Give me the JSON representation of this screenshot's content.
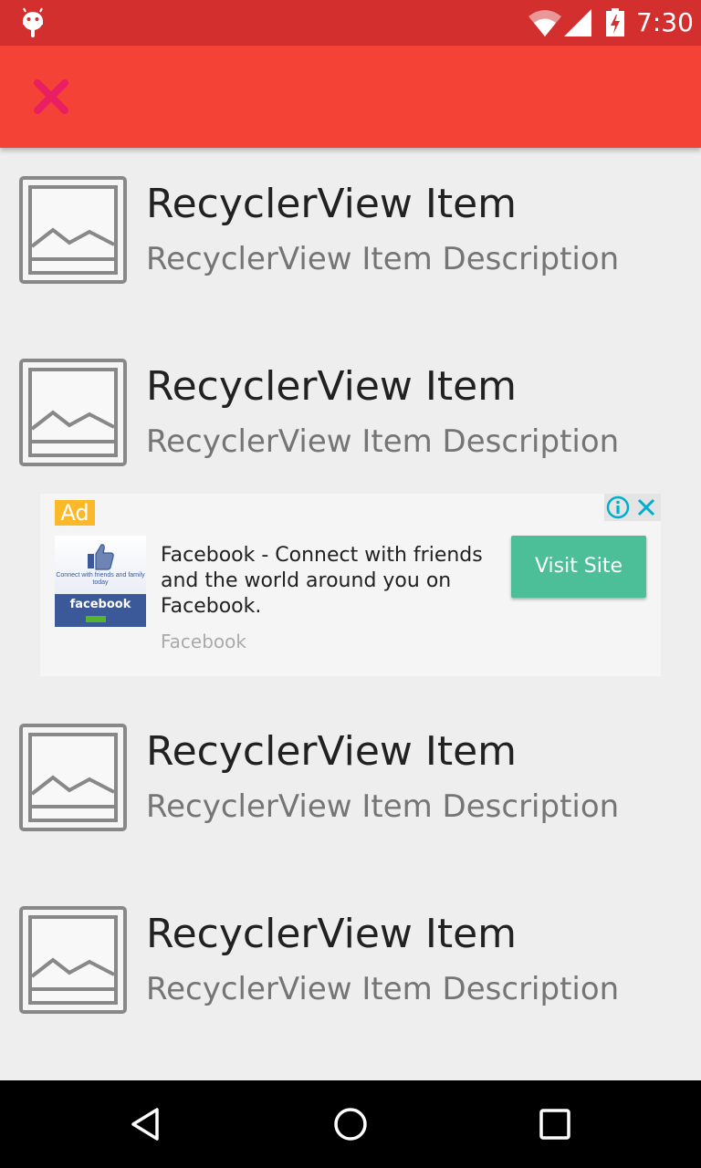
{
  "status_bar": {
    "time": "7:30",
    "background_color": "#d32f2f",
    "icons": [
      "android-icon",
      "wifi-icon",
      "signal-icon",
      "battery-charging-icon"
    ]
  },
  "app_bar": {
    "background_color": "#f44336",
    "close_icon_color": "#e91e63",
    "close_icon": "close-icon"
  },
  "list": {
    "items": [
      {
        "title": "RecyclerView Item",
        "description": "RecyclerView Item Description",
        "icon": "image-placeholder-icon"
      },
      {
        "title": "RecyclerView Item",
        "description": "RecyclerView Item Description",
        "icon": "image-placeholder-icon"
      },
      {
        "title": "RecyclerView Item",
        "description": "RecyclerView Item Description",
        "icon": "image-placeholder-icon"
      },
      {
        "title": "RecyclerView Item",
        "description": "RecyclerView Item Description",
        "icon": "image-placeholder-icon"
      }
    ]
  },
  "ad": {
    "badge": "Ad",
    "badge_color": "#fbb829",
    "image_tagline": "Connect with friends and family today",
    "image_brand": "facebook",
    "headline": "Facebook - Connect with friends and the world around you on Facebook.",
    "source": "Facebook",
    "cta_label": "Visit Site",
    "cta_color": "#4cbf99",
    "choices_icons": [
      "info-icon",
      "close-icon"
    ],
    "choices_color": "#00aecd"
  },
  "nav_bar": {
    "buttons": [
      "back-icon",
      "home-icon",
      "recents-icon"
    ]
  }
}
